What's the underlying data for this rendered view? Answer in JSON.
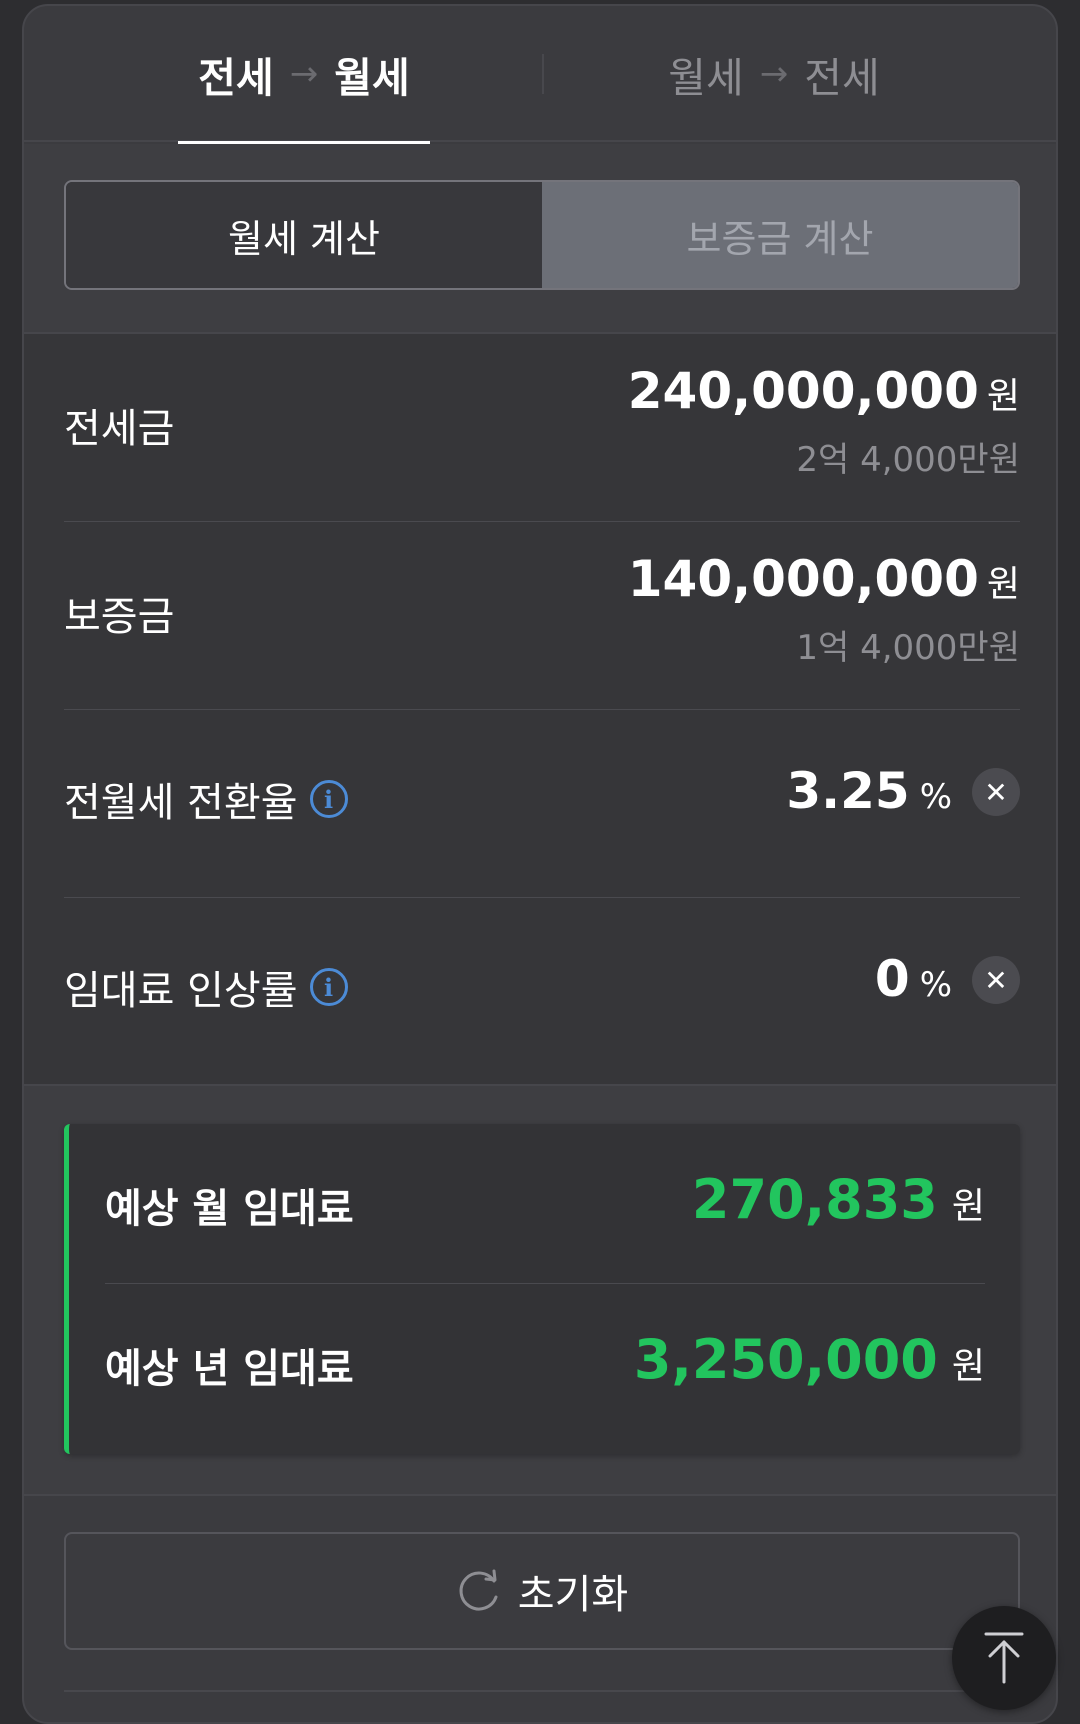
{
  "tabs": {
    "active": {
      "from": "전세",
      "arrow": "→",
      "to": "월세"
    },
    "inactive": {
      "from": "월세",
      "arrow": "→",
      "to": "전세"
    }
  },
  "segment": {
    "monthly": "월세 계산",
    "deposit": "보증금 계산"
  },
  "rows": {
    "jeonse": {
      "label": "전세금",
      "value": "240,000,000",
      "unit": "원",
      "sub": "2억 4,000만원"
    },
    "deposit": {
      "label": "보증금",
      "value": "140,000,000",
      "unit": "원",
      "sub": "1억 4,000만원"
    },
    "conversion": {
      "label": "전월세 전환율",
      "value": "3.25",
      "unit": "%"
    },
    "increase": {
      "label": "임대료 인상률",
      "value": "0",
      "unit": "%"
    }
  },
  "results": {
    "monthly": {
      "label": "예상 월 임대료",
      "value": "270,833",
      "unit": "원"
    },
    "yearly": {
      "label": "예상 년 임대료",
      "value": "3,250,000",
      "unit": "원"
    }
  },
  "reset": {
    "label": "초기화"
  },
  "icons": {
    "info": "info-icon",
    "clear": "close-icon",
    "reset": "refresh-icon",
    "scroll_top": "arrow-up-icon"
  },
  "colors": {
    "accent_green": "#22c55e",
    "info_blue": "#4c8bd6",
    "background": "#3b3b3f"
  }
}
